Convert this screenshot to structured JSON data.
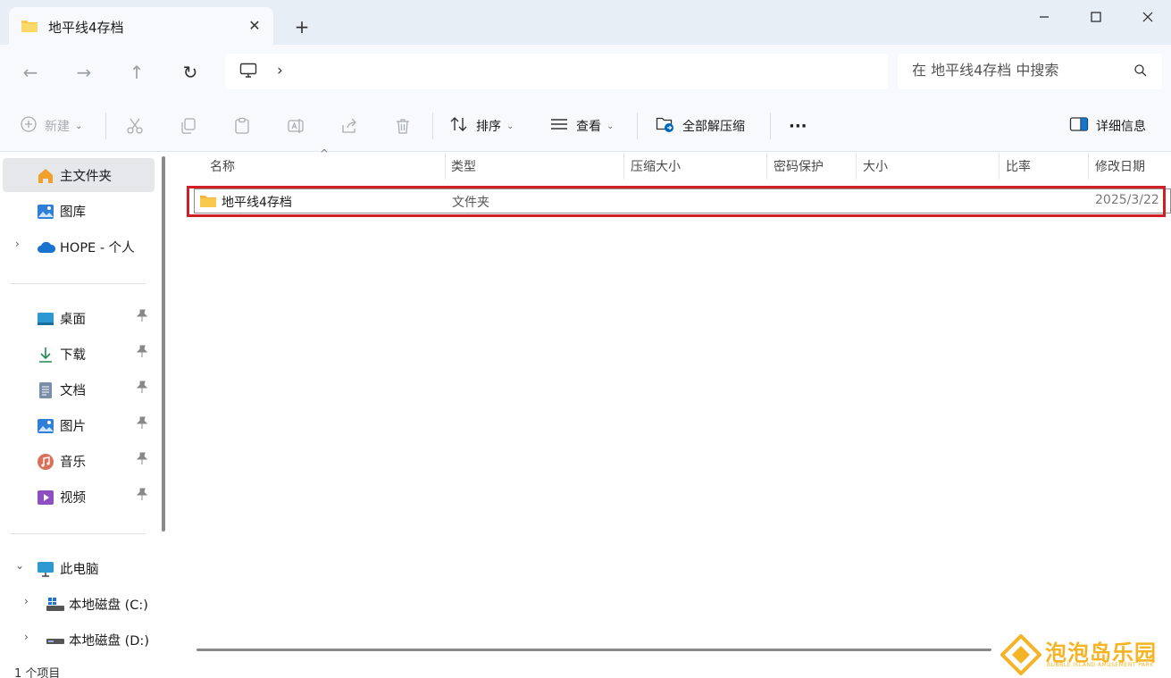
{
  "window": {
    "tab_title": "地平线4存档",
    "tab_close": "✕",
    "new_tab": "+",
    "controls": {
      "minimize": "—",
      "maximize": "☐",
      "close": "✕"
    }
  },
  "address_bar": {
    "back": "←",
    "forward": "→",
    "up": "↑",
    "refresh": "↻",
    "path_icon": "computer-icon",
    "separator": "›",
    "search_placeholder": "在 地平线4存档 中搜索"
  },
  "toolbar": {
    "new_label": "新建",
    "sort_label": "排序",
    "view_label": "查看",
    "extract_label": "全部解压缩",
    "more_label": "···",
    "details_label": "详细信息",
    "dropdown": "⌄"
  },
  "sidebar": {
    "items": [
      {
        "label": "主文件夹",
        "icon": "home-icon"
      },
      {
        "label": "图库",
        "icon": "gallery-icon"
      },
      {
        "label": "HOPE - 个人",
        "icon": "onedrive-cloud-icon"
      },
      {
        "label": "桌面",
        "icon": "desktop-icon"
      },
      {
        "label": "下载",
        "icon": "download-icon"
      },
      {
        "label": "文档",
        "icon": "document-icon"
      },
      {
        "label": "图片",
        "icon": "pictures-icon"
      },
      {
        "label": "音乐",
        "icon": "music-icon"
      },
      {
        "label": "视频",
        "icon": "video-icon"
      },
      {
        "label": "此电脑",
        "icon": "this-pc-icon"
      },
      {
        "label": "本地磁盘 (C:)",
        "icon": "drive-c-icon"
      },
      {
        "label": "本地磁盘 (D:)",
        "icon": "drive-d-icon"
      }
    ],
    "pin_glyph": "📌",
    "expand_glyph": "›",
    "collapse_glyph": "⌄"
  },
  "columns": [
    "名称",
    "类型",
    "压缩大小",
    "密码保护",
    "大小",
    "比率",
    "修改日期"
  ],
  "sort_caret": "^",
  "rows": [
    {
      "name": "地平线4存档",
      "type": "文件夹",
      "modified": "2025/3/22"
    }
  ],
  "status": {
    "count": "1 个项目"
  },
  "watermark": {
    "title": "泡泡岛乐园",
    "subtitle": "BUBBLE ISLAND AMUSEMENT PARK"
  },
  "colors": {
    "highlight": "#d01f26",
    "accent": "#0067c0",
    "folder": "#f8c94c",
    "watermark": "#f5b326"
  }
}
